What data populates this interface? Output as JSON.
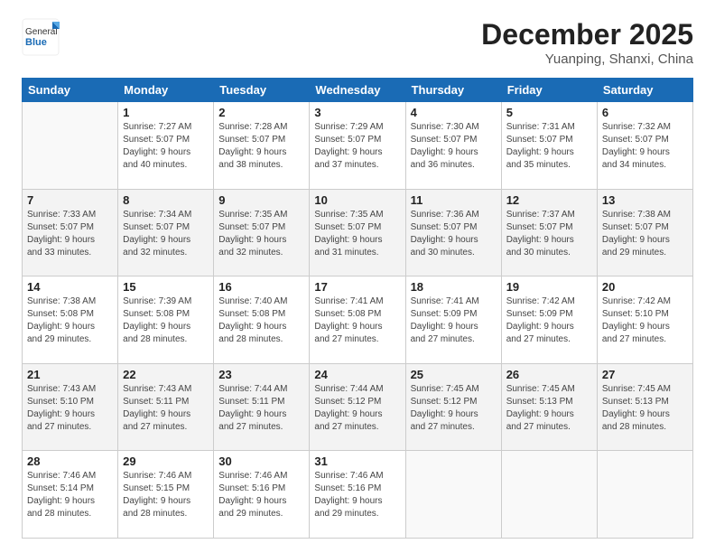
{
  "logo": {
    "general": "General",
    "blue": "Blue"
  },
  "header": {
    "month": "December 2025",
    "location": "Yuanping, Shanxi, China"
  },
  "weekdays": [
    "Sunday",
    "Monday",
    "Tuesday",
    "Wednesday",
    "Thursday",
    "Friday",
    "Saturday"
  ],
  "weeks": [
    [
      {
        "day": "",
        "info": ""
      },
      {
        "day": "1",
        "info": "Sunrise: 7:27 AM\nSunset: 5:07 PM\nDaylight: 9 hours\nand 40 minutes."
      },
      {
        "day": "2",
        "info": "Sunrise: 7:28 AM\nSunset: 5:07 PM\nDaylight: 9 hours\nand 38 minutes."
      },
      {
        "day": "3",
        "info": "Sunrise: 7:29 AM\nSunset: 5:07 PM\nDaylight: 9 hours\nand 37 minutes."
      },
      {
        "day": "4",
        "info": "Sunrise: 7:30 AM\nSunset: 5:07 PM\nDaylight: 9 hours\nand 36 minutes."
      },
      {
        "day": "5",
        "info": "Sunrise: 7:31 AM\nSunset: 5:07 PM\nDaylight: 9 hours\nand 35 minutes."
      },
      {
        "day": "6",
        "info": "Sunrise: 7:32 AM\nSunset: 5:07 PM\nDaylight: 9 hours\nand 34 minutes."
      }
    ],
    [
      {
        "day": "7",
        "info": "Sunrise: 7:33 AM\nSunset: 5:07 PM\nDaylight: 9 hours\nand 33 minutes."
      },
      {
        "day": "8",
        "info": "Sunrise: 7:34 AM\nSunset: 5:07 PM\nDaylight: 9 hours\nand 32 minutes."
      },
      {
        "day": "9",
        "info": "Sunrise: 7:35 AM\nSunset: 5:07 PM\nDaylight: 9 hours\nand 32 minutes."
      },
      {
        "day": "10",
        "info": "Sunrise: 7:35 AM\nSunset: 5:07 PM\nDaylight: 9 hours\nand 31 minutes."
      },
      {
        "day": "11",
        "info": "Sunrise: 7:36 AM\nSunset: 5:07 PM\nDaylight: 9 hours\nand 30 minutes."
      },
      {
        "day": "12",
        "info": "Sunrise: 7:37 AM\nSunset: 5:07 PM\nDaylight: 9 hours\nand 30 minutes."
      },
      {
        "day": "13",
        "info": "Sunrise: 7:38 AM\nSunset: 5:07 PM\nDaylight: 9 hours\nand 29 minutes."
      }
    ],
    [
      {
        "day": "14",
        "info": "Sunrise: 7:38 AM\nSunset: 5:08 PM\nDaylight: 9 hours\nand 29 minutes."
      },
      {
        "day": "15",
        "info": "Sunrise: 7:39 AM\nSunset: 5:08 PM\nDaylight: 9 hours\nand 28 minutes."
      },
      {
        "day": "16",
        "info": "Sunrise: 7:40 AM\nSunset: 5:08 PM\nDaylight: 9 hours\nand 28 minutes."
      },
      {
        "day": "17",
        "info": "Sunrise: 7:41 AM\nSunset: 5:08 PM\nDaylight: 9 hours\nand 27 minutes."
      },
      {
        "day": "18",
        "info": "Sunrise: 7:41 AM\nSunset: 5:09 PM\nDaylight: 9 hours\nand 27 minutes."
      },
      {
        "day": "19",
        "info": "Sunrise: 7:42 AM\nSunset: 5:09 PM\nDaylight: 9 hours\nand 27 minutes."
      },
      {
        "day": "20",
        "info": "Sunrise: 7:42 AM\nSunset: 5:10 PM\nDaylight: 9 hours\nand 27 minutes."
      }
    ],
    [
      {
        "day": "21",
        "info": "Sunrise: 7:43 AM\nSunset: 5:10 PM\nDaylight: 9 hours\nand 27 minutes."
      },
      {
        "day": "22",
        "info": "Sunrise: 7:43 AM\nSunset: 5:11 PM\nDaylight: 9 hours\nand 27 minutes."
      },
      {
        "day": "23",
        "info": "Sunrise: 7:44 AM\nSunset: 5:11 PM\nDaylight: 9 hours\nand 27 minutes."
      },
      {
        "day": "24",
        "info": "Sunrise: 7:44 AM\nSunset: 5:12 PM\nDaylight: 9 hours\nand 27 minutes."
      },
      {
        "day": "25",
        "info": "Sunrise: 7:45 AM\nSunset: 5:12 PM\nDaylight: 9 hours\nand 27 minutes."
      },
      {
        "day": "26",
        "info": "Sunrise: 7:45 AM\nSunset: 5:13 PM\nDaylight: 9 hours\nand 27 minutes."
      },
      {
        "day": "27",
        "info": "Sunrise: 7:45 AM\nSunset: 5:13 PM\nDaylight: 9 hours\nand 28 minutes."
      }
    ],
    [
      {
        "day": "28",
        "info": "Sunrise: 7:46 AM\nSunset: 5:14 PM\nDaylight: 9 hours\nand 28 minutes."
      },
      {
        "day": "29",
        "info": "Sunrise: 7:46 AM\nSunset: 5:15 PM\nDaylight: 9 hours\nand 28 minutes."
      },
      {
        "day": "30",
        "info": "Sunrise: 7:46 AM\nSunset: 5:16 PM\nDaylight: 9 hours\nand 29 minutes."
      },
      {
        "day": "31",
        "info": "Sunrise: 7:46 AM\nSunset: 5:16 PM\nDaylight: 9 hours\nand 29 minutes."
      },
      {
        "day": "",
        "info": ""
      },
      {
        "day": "",
        "info": ""
      },
      {
        "day": "",
        "info": ""
      }
    ]
  ]
}
